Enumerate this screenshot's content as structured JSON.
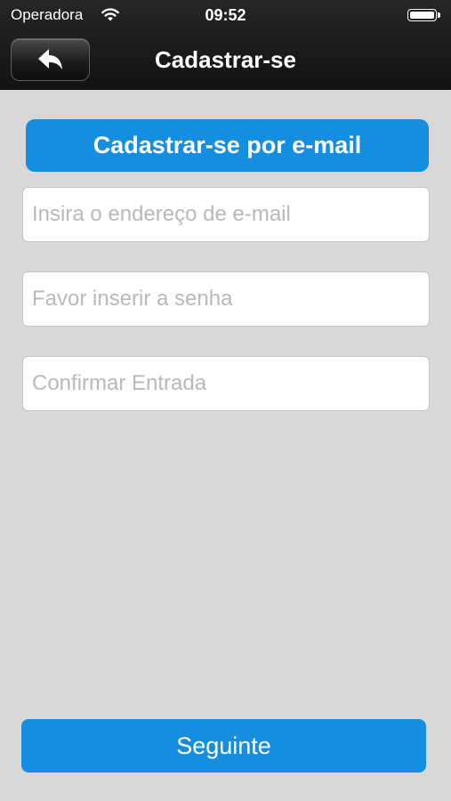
{
  "status_bar": {
    "carrier": "Operadora",
    "time": "09:52",
    "wifi_icon": "wifi-icon",
    "battery_icon": "battery-icon"
  },
  "nav_bar": {
    "title": "Cadastrar-se",
    "back_icon": "back-arrow-icon"
  },
  "form": {
    "header": "Cadastrar-se por e-mail",
    "email_placeholder": "Insira o endereço de e-mail",
    "email_value": "",
    "password_placeholder": "Favor inserir a senha",
    "password_value": "",
    "confirm_placeholder": "Confirmar Entrada",
    "confirm_value": ""
  },
  "footer": {
    "next_label": "Seguinte"
  },
  "colors": {
    "accent": "#168ee0",
    "background": "#d8d8d8",
    "navbar": "#1a1a1a"
  }
}
